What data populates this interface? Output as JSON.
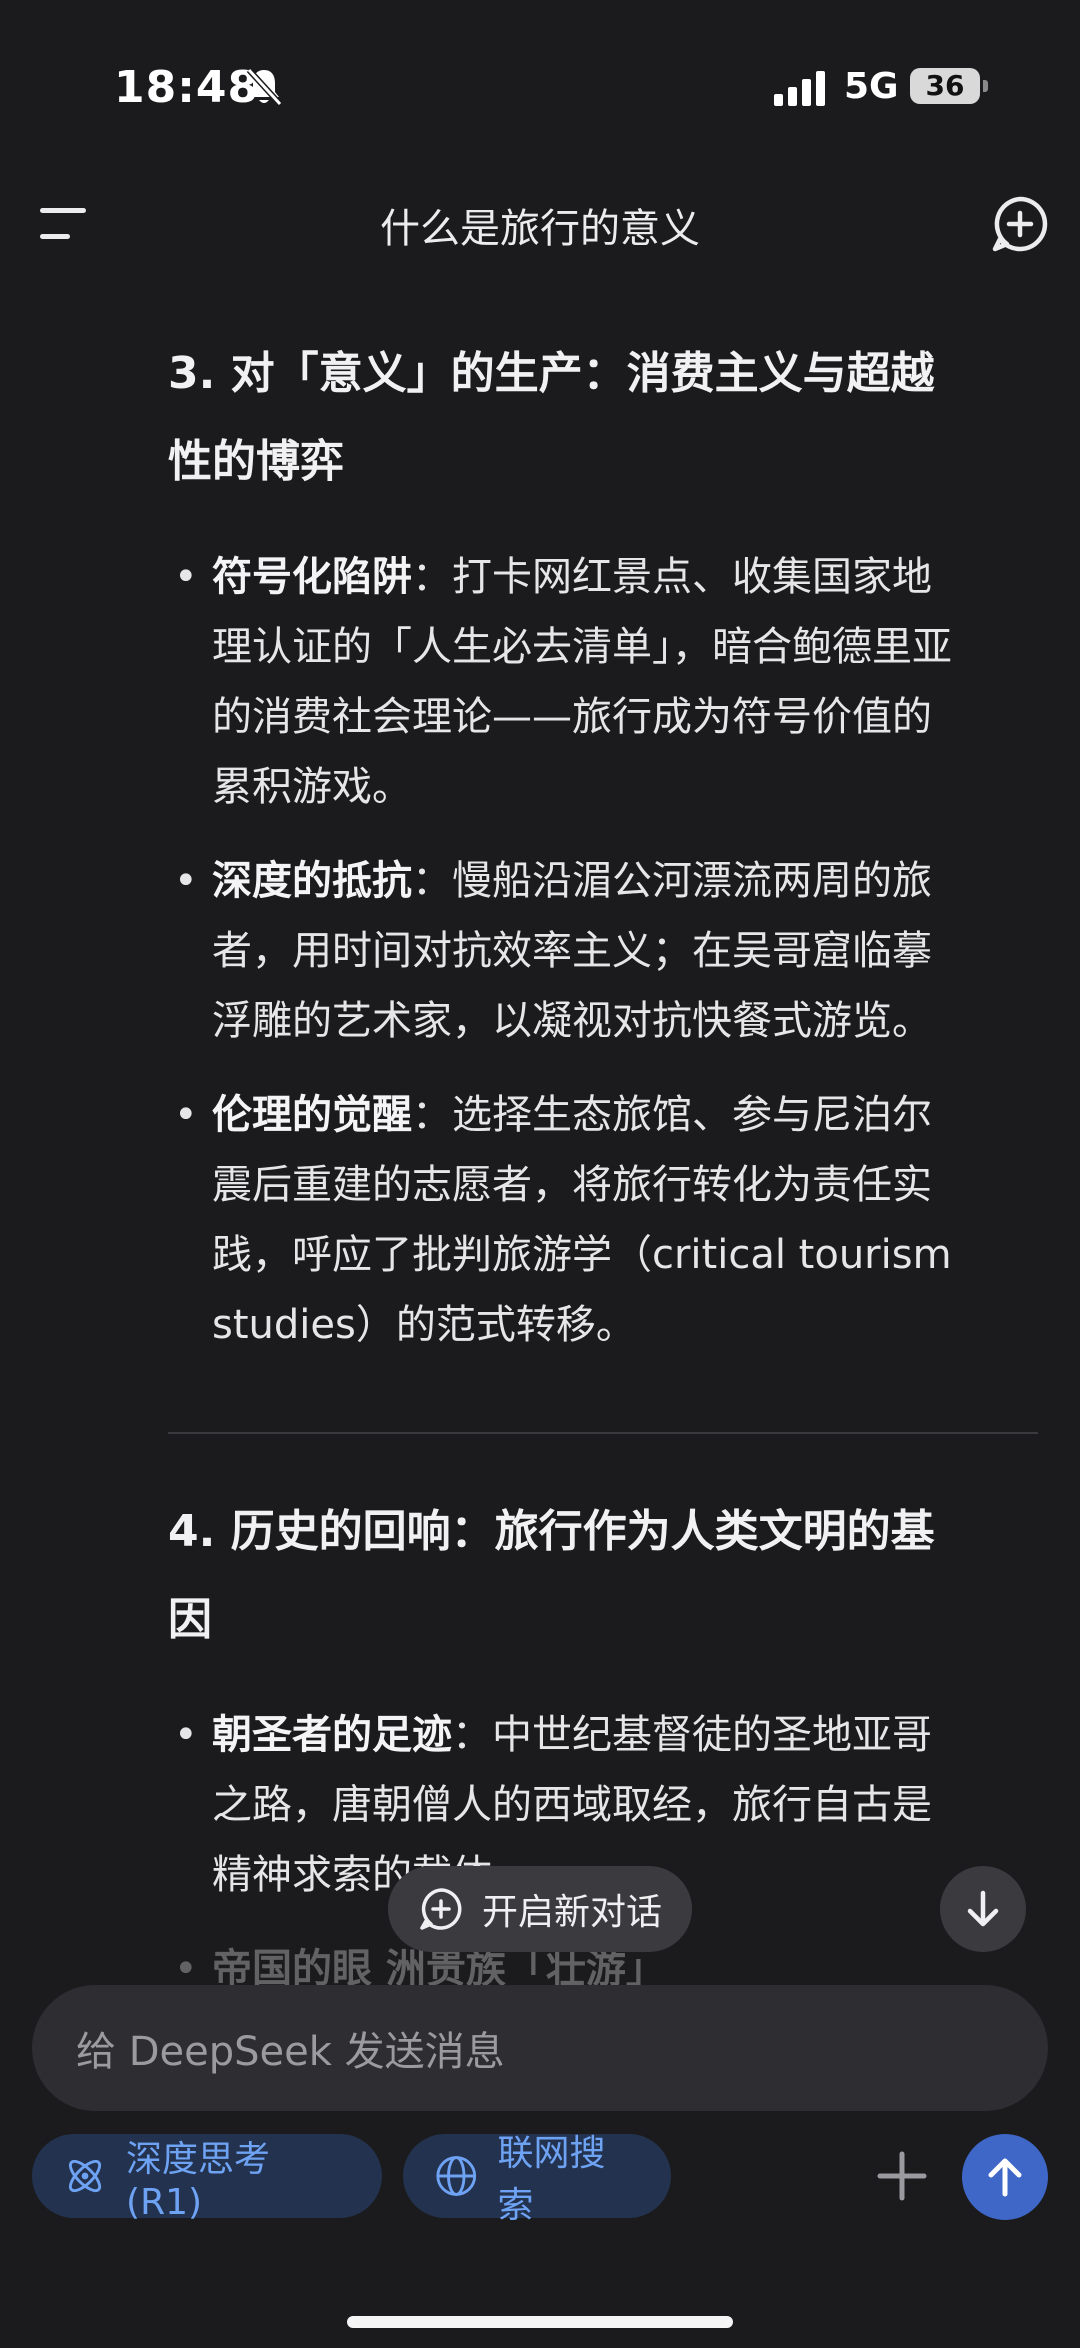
{
  "status": {
    "time": "18:48",
    "network": "5G",
    "battery": "36"
  },
  "header": {
    "title": "什么是旅行的意义"
  },
  "sections": [
    {
      "heading_line1": "3. 对「意义」的生产：消费主义与超越",
      "heading_line2": "性的博弈",
      "bullets": [
        {
          "term": "符号化陷阱",
          "lines": [
            "：打卡网红景点、收集国家地",
            "理认证的「人生必去清单」，暗合鲍德里亚",
            "的消费社会理论——旅行成为符号价值的",
            "累积游戏。"
          ]
        },
        {
          "term": "深度的抵抗",
          "lines": [
            "：慢船沿湄公河漂流两周的旅",
            "者，用时间对抗效率主义；在吴哥窟临摹",
            "浮雕的艺术家，以凝视对抗快餐式游览。"
          ]
        },
        {
          "term": "伦理的觉醒",
          "lines": [
            "：选择生态旅馆、参与尼泊尔",
            "震后重建的志愿者，将旅行转化为责任实",
            "践，呼应了批判旅游学（critical tourism",
            "studies）的范式转移。"
          ]
        }
      ]
    },
    {
      "heading_line1": "4. 历史的回响：旅行作为人类文明的基",
      "heading_line2": "因",
      "bullets": [
        {
          "term": "朝圣者的足迹",
          "lines": [
            "：中世纪基督徒的圣地亚哥",
            "之路，唐朝僧人的西域取经，旅行自古是",
            "精神求索的载体。"
          ]
        }
      ],
      "partial_bullet": "帝国的眼                  洲贵族「壮游」"
    }
  ],
  "floating": {
    "new_chat_label": "开启新对话"
  },
  "composer": {
    "placeholder": "给 DeepSeek 发送消息",
    "deep_think_label": "深度思考 (R1)",
    "web_search_label": "联网搜索"
  },
  "colors": {
    "background": "#1b1b1d",
    "chip_bg": "#23324e",
    "chip_text": "#6ea2f3",
    "send_button": "#3e67c8"
  }
}
